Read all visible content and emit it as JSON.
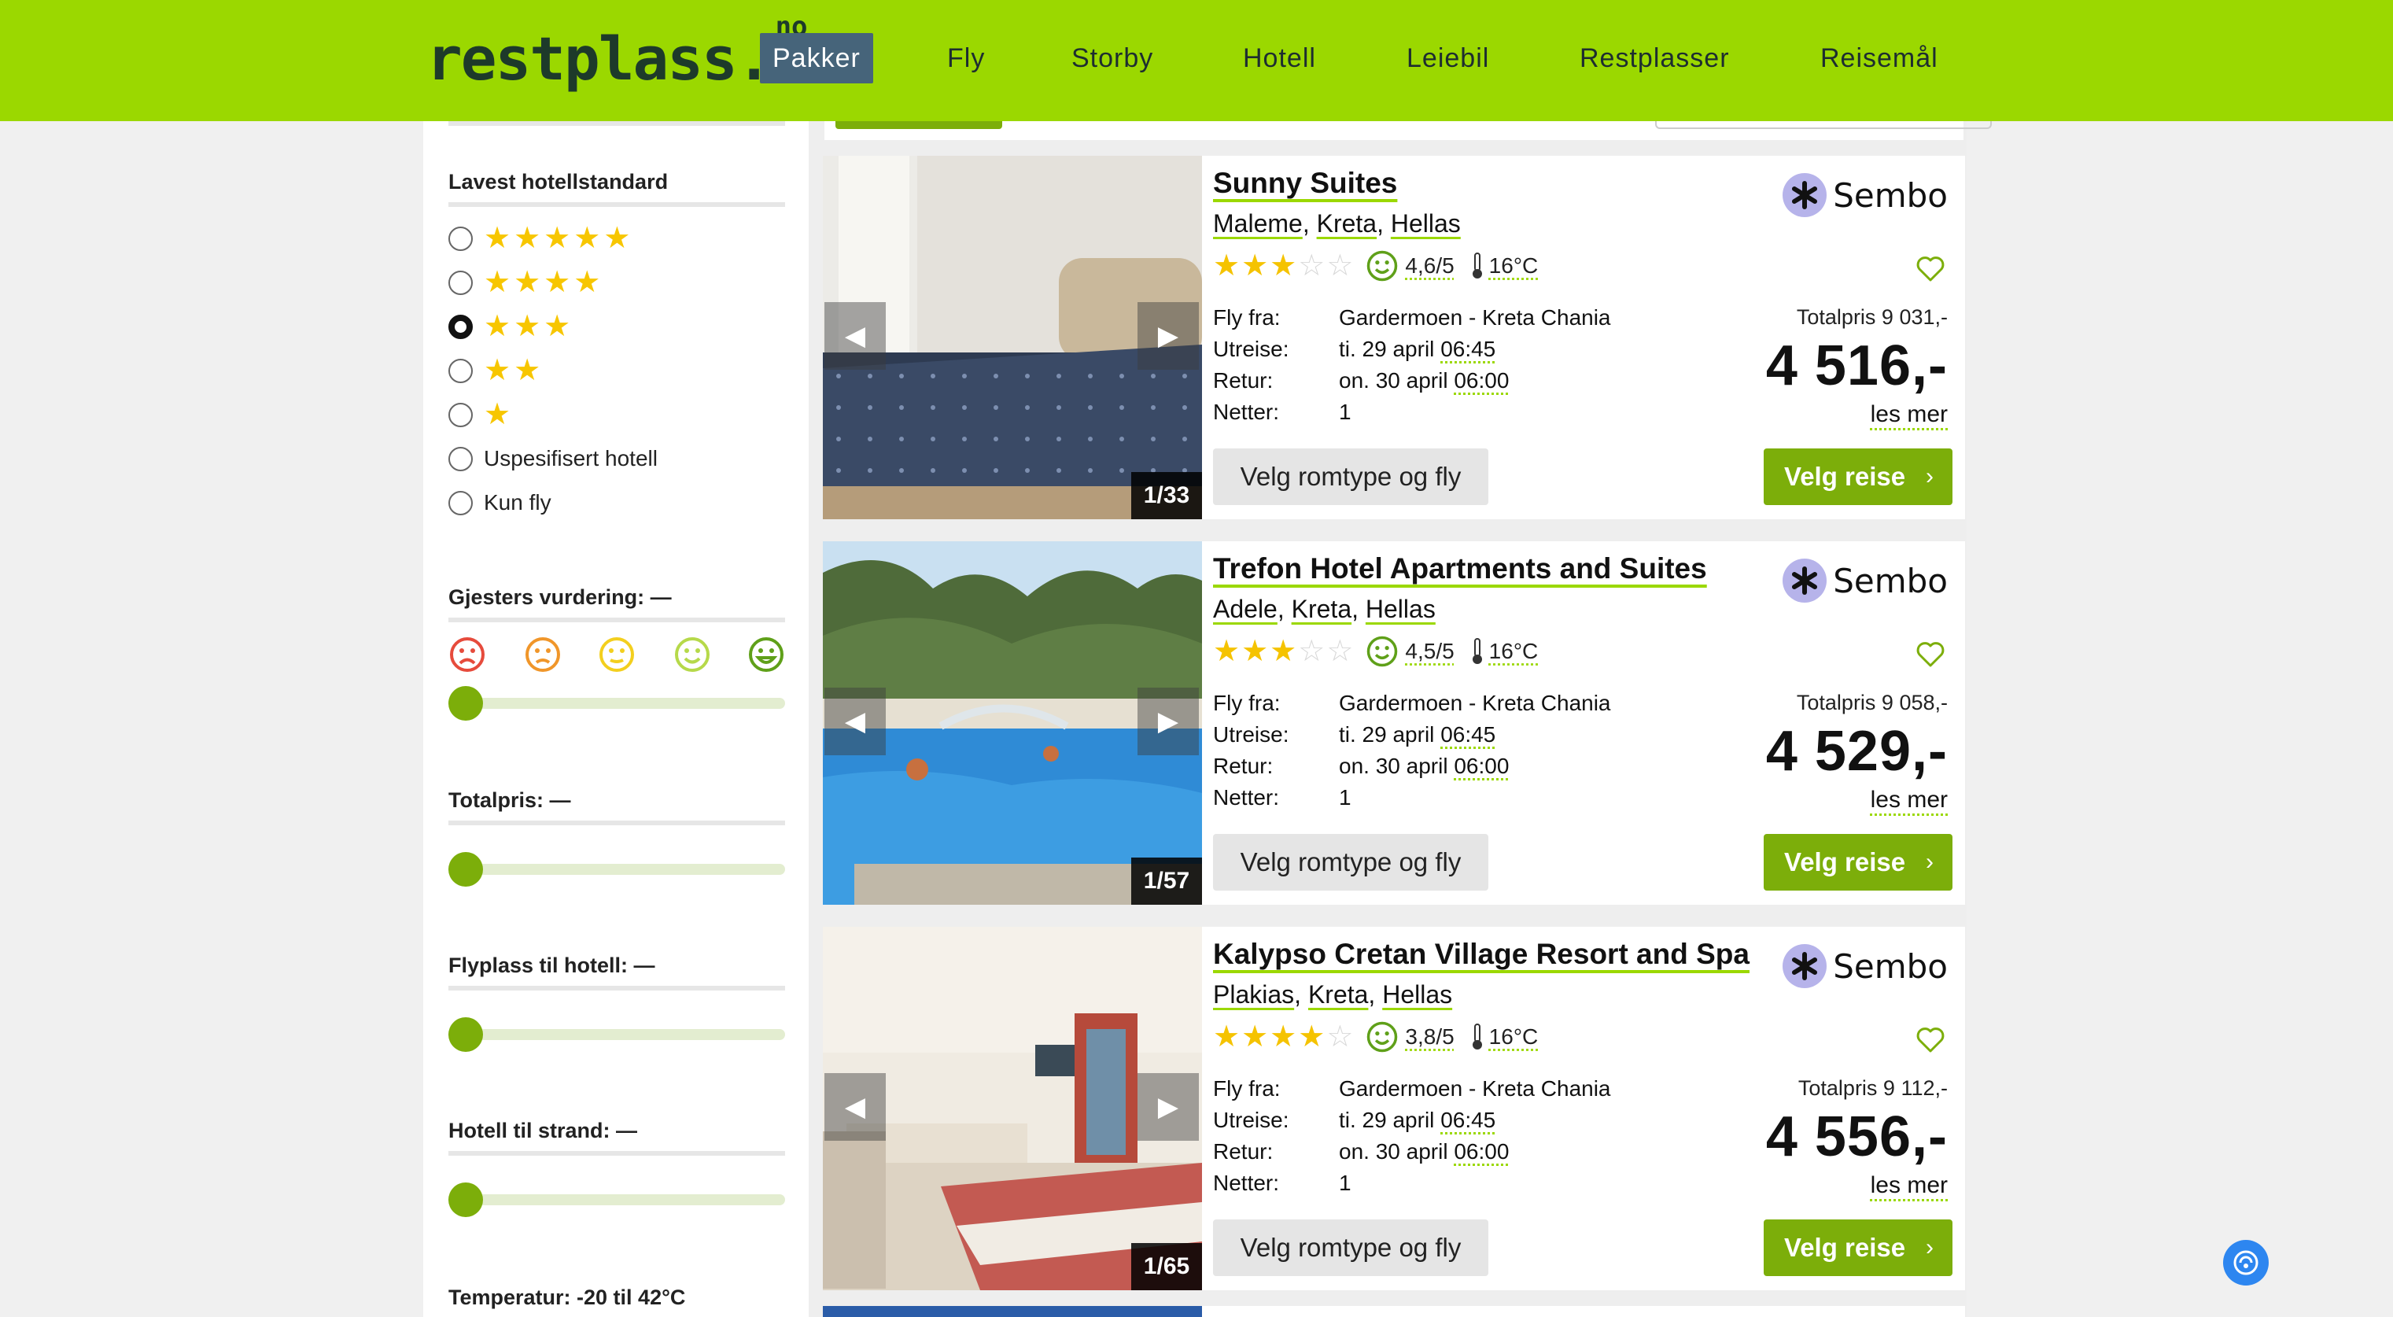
{
  "header": {
    "logo": "restplass.",
    "logo_sup": "no",
    "nav": [
      "Pakker",
      "Fly",
      "Storby",
      "Hotell",
      "Leiebil",
      "Restplasser",
      "Reisemål"
    ]
  },
  "filters": {
    "hotel_standard_title": "Lavest hotellstandard",
    "standard_options": [
      {
        "stars": 5,
        "label": ""
      },
      {
        "stars": 4,
        "label": ""
      },
      {
        "stars": 3,
        "label": "",
        "checked": true
      },
      {
        "stars": 2,
        "label": ""
      },
      {
        "stars": 1,
        "label": ""
      },
      {
        "stars": 0,
        "label": "Uspesifisert hotell"
      },
      {
        "stars": 0,
        "label": "Kun fly"
      }
    ],
    "guest_rating_title": "Gjesters vurdering: —",
    "total_price_title": "Totalpris: —",
    "airport_title": "Flyplass til hotell: —",
    "beach_title": "Hotell til strand: —",
    "temperature_title": "Temperatur: -20 til 42°C"
  },
  "cards": [
    {
      "name": "Sunny Suites",
      "location": [
        "Maleme",
        "Kreta",
        "Hellas"
      ],
      "stars": 3,
      "score": "4,6/5",
      "temp": "16°C",
      "labels": {
        "from": "Fly fra:",
        "out": "Utreise:",
        "ret": "Retur:",
        "nights": "Netter:"
      },
      "from": "Gardermoen - Kreta Chania",
      "out_date": "ti. 29 april",
      "out_time": "06:45",
      "ret_date": "on. 30 april",
      "ret_time": "06:00",
      "nights": "1",
      "brand": "Sembo",
      "totalpris": "Totalpris 9 031,-",
      "price": "4 516,-",
      "les_mer": "les mer",
      "btn_room": "Velg romtype og fly",
      "btn_select": "Velg reise",
      "counter": "1/33"
    },
    {
      "name": "Trefon Hotel Apartments and Suites",
      "location": [
        "Adele",
        "Kreta",
        "Hellas"
      ],
      "stars": 3,
      "score": "4,5/5",
      "temp": "16°C",
      "labels": {
        "from": "Fly fra:",
        "out": "Utreise:",
        "ret": "Retur:",
        "nights": "Netter:"
      },
      "from": "Gardermoen - Kreta Chania",
      "out_date": "ti. 29 april",
      "out_time": "06:45",
      "ret_date": "on. 30 april",
      "ret_time": "06:00",
      "nights": "1",
      "brand": "Sembo",
      "totalpris": "Totalpris 9 058,-",
      "price": "4 529,-",
      "les_mer": "les mer",
      "btn_room": "Velg romtype og fly",
      "btn_select": "Velg reise",
      "counter": "1/57"
    },
    {
      "name": "Kalypso Cretan Village Resort and Spa",
      "location": [
        "Plakias",
        "Kreta",
        "Hellas"
      ],
      "stars": 4,
      "score": "3,8/5",
      "temp": "16°C",
      "labels": {
        "from": "Fly fra:",
        "out": "Utreise:",
        "ret": "Retur:",
        "nights": "Netter:"
      },
      "from": "Gardermoen - Kreta Chania",
      "out_date": "ti. 29 april",
      "out_time": "06:45",
      "ret_date": "on. 30 april",
      "ret_time": "06:00",
      "nights": "1",
      "brand": "Sembo",
      "totalpris": "Totalpris 9 112,-",
      "price": "4 556,-",
      "les_mer": "les mer",
      "btn_room": "Velg romtype og fly",
      "btn_select": "Velg reise",
      "counter": "1/65"
    }
  ],
  "colors": {
    "brand_green": "#9bd800",
    "button_green": "#7cae0a",
    "nav_active": "#46647a",
    "star": "#f5c300"
  }
}
